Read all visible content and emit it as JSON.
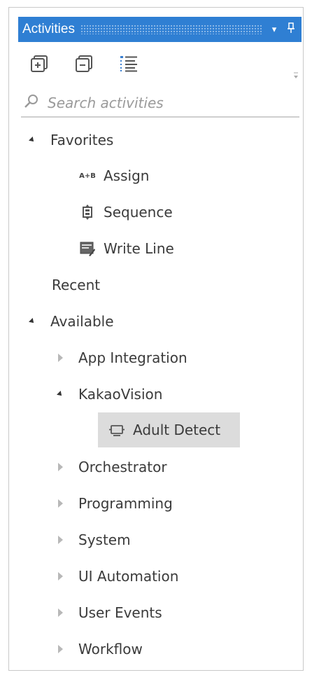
{
  "panel": {
    "title": "Activities",
    "pin_glyph": "▾",
    "pin_icon_glyph": "⊥"
  },
  "toolbar": {
    "buttons": [
      {
        "name": "expand-all-icon"
      },
      {
        "name": "collapse-all-icon"
      },
      {
        "name": "show-list-icon"
      }
    ]
  },
  "search": {
    "placeholder": "Search activities"
  },
  "tree": {
    "favorites": {
      "label": "Favorites",
      "items": [
        {
          "label": "Assign",
          "icon": "assign-icon",
          "icon_text": "A+B"
        },
        {
          "label": "Sequence",
          "icon": "sequence-icon"
        },
        {
          "label": "Write Line",
          "icon": "write-line-icon"
        }
      ]
    },
    "recent": {
      "label": "Recent"
    },
    "available": {
      "label": "Available",
      "groups": [
        {
          "label": "App Integration",
          "expanded": false
        },
        {
          "label": "KakaoVision",
          "expanded": true,
          "children": [
            {
              "label": "Adult Detect",
              "icon": "activity-icon",
              "selected": true
            }
          ]
        },
        {
          "label": "Orchestrator",
          "expanded": false
        },
        {
          "label": "Programming",
          "expanded": false
        },
        {
          "label": "System",
          "expanded": false
        },
        {
          "label": "UI Automation",
          "expanded": false
        },
        {
          "label": "User Events",
          "expanded": false
        },
        {
          "label": "Workflow",
          "expanded": false
        }
      ]
    }
  },
  "colors": {
    "title_bg": "#2f7fd3",
    "selected_bg": "#dcdcdc",
    "text": "#3b3b3b"
  }
}
